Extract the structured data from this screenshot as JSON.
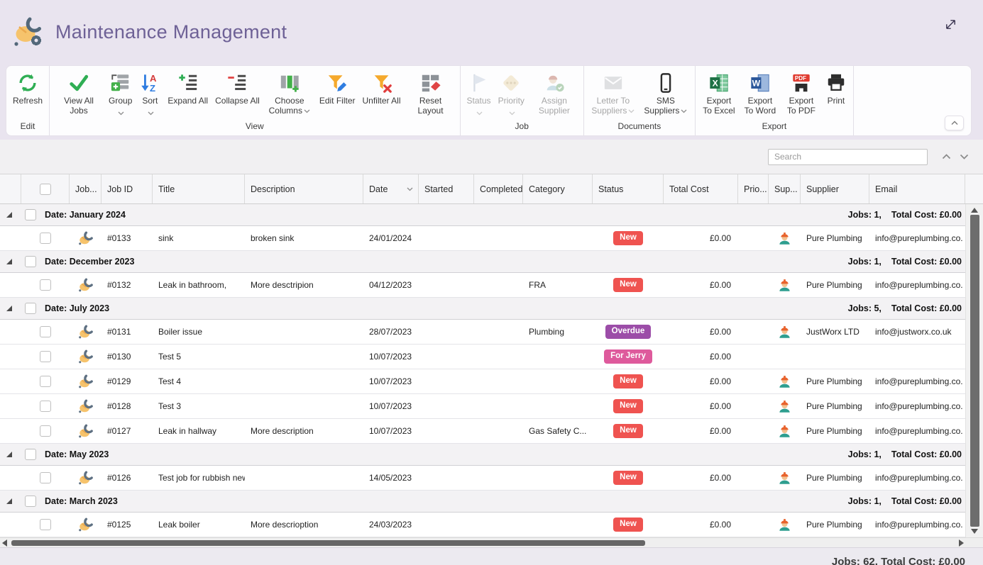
{
  "header": {
    "title": "Maintenance Management"
  },
  "ribbon": {
    "groups": [
      {
        "label": "Edit",
        "buttons": [
          {
            "label": "Refresh",
            "icon": "refresh-icon",
            "enabled": true,
            "dropdown": "none"
          }
        ]
      },
      {
        "label": "View",
        "buttons": [
          {
            "label": "View All Jobs",
            "icon": "check-icon",
            "enabled": true,
            "dropdown": "none"
          },
          {
            "label": "Group",
            "icon": "group-icon",
            "enabled": true,
            "dropdown": "below"
          },
          {
            "label": "Sort",
            "icon": "sort-az-icon",
            "enabled": true,
            "dropdown": "below"
          },
          {
            "label": "Expand All",
            "icon": "expand-all-icon",
            "enabled": true,
            "dropdown": "none"
          },
          {
            "label": "Collapse All",
            "icon": "collapse-all-icon",
            "enabled": true,
            "dropdown": "none"
          },
          {
            "label": "Choose Columns",
            "icon": "choose-columns-icon",
            "enabled": true,
            "dropdown": "inline"
          },
          {
            "label": "Edit Filter",
            "icon": "edit-filter-icon",
            "enabled": true,
            "dropdown": "none"
          },
          {
            "label": "Unfilter All",
            "icon": "unfilter-icon",
            "enabled": true,
            "dropdown": "none"
          },
          {
            "label": "Reset Layout",
            "icon": "reset-layout-icon",
            "enabled": true,
            "dropdown": "none"
          }
        ]
      },
      {
        "label": "Job",
        "buttons": [
          {
            "label": "Status",
            "icon": "status-flag-icon",
            "enabled": false,
            "dropdown": "below"
          },
          {
            "label": "Priority",
            "icon": "priority-icon",
            "enabled": false,
            "dropdown": "below"
          },
          {
            "label": "Assign Supplier",
            "icon": "assign-supplier-icon",
            "enabled": false,
            "dropdown": "none"
          }
        ]
      },
      {
        "label": "Documents",
        "buttons": [
          {
            "label": "Letter To Suppliers",
            "icon": "letter-icon",
            "enabled": false,
            "dropdown": "inline"
          },
          {
            "label": "SMS Suppliers",
            "icon": "sms-icon",
            "enabled": true,
            "dropdown": "inline"
          }
        ]
      },
      {
        "label": "Export",
        "buttons": [
          {
            "label": "Export To Excel",
            "icon": "excel-icon",
            "enabled": true,
            "dropdown": "none"
          },
          {
            "label": "Export To Word",
            "icon": "word-icon",
            "enabled": true,
            "dropdown": "none"
          },
          {
            "label": "Export To PDF",
            "icon": "pdf-icon",
            "enabled": true,
            "dropdown": "none"
          },
          {
            "label": "Print",
            "icon": "print-icon",
            "enabled": true,
            "dropdown": "none"
          }
        ]
      }
    ]
  },
  "search": {
    "placeholder": "Search"
  },
  "colors": {
    "accent_purple": "#6e6196",
    "status_colors": {
      "New": "#ef5350",
      "Overdue": "#9c4da8",
      "For Jerry": "#de5a9c"
    }
  },
  "grid": {
    "columns": [
      "",
      "",
      "Job...",
      "Job ID",
      "Title",
      "Description",
      "Date",
      "Started",
      "Completed",
      "Category",
      "Status",
      "Total Cost",
      "Prio...",
      "Sup...",
      "Supplier",
      "Email"
    ],
    "groups": [
      {
        "label": "Date: January 2024",
        "jobs": "Jobs: 1,",
        "total_cost": "Total Cost: £0.00",
        "rows": [
          {
            "job_id": "#0133",
            "title": "sink",
            "description": "broken sink",
            "date": "24/01/2024",
            "started": "",
            "completed": "",
            "category": "",
            "status": "New",
            "total_cost": "£0.00",
            "supplier": "Pure Plumbing",
            "email": "info@pureplumbing.co."
          }
        ]
      },
      {
        "label": "Date: December 2023",
        "jobs": "Jobs: 1,",
        "total_cost": "Total Cost: £0.00",
        "rows": [
          {
            "job_id": "#0132",
            "title": "Leak in bathroom,",
            "description": "More desctripion",
            "date": "04/12/2023",
            "started": "",
            "completed": "",
            "category": "FRA",
            "status": "New",
            "total_cost": "£0.00",
            "supplier": "Pure Plumbing",
            "email": "info@pureplumbing.co."
          }
        ]
      },
      {
        "label": "Date: July 2023",
        "jobs": "Jobs: 5,",
        "total_cost": "Total Cost: £0.00",
        "rows": [
          {
            "job_id": "#0131",
            "title": "Boiler issue",
            "description": "",
            "date": "28/07/2023",
            "started": "",
            "completed": "",
            "category": "Plumbing",
            "status": "Overdue",
            "total_cost": "£0.00",
            "supplier": "JustWorx LTD",
            "email": "info@justworx.co.uk"
          },
          {
            "job_id": "#0130",
            "title": "Test 5",
            "description": "",
            "date": "10/07/2023",
            "started": "",
            "completed": "",
            "category": "",
            "status": "For Jerry",
            "total_cost": "£0.00",
            "supplier": "",
            "email": ""
          },
          {
            "job_id": "#0129",
            "title": "Test 4",
            "description": "",
            "date": "10/07/2023",
            "started": "",
            "completed": "",
            "category": "",
            "status": "New",
            "total_cost": "£0.00",
            "supplier": "Pure Plumbing",
            "email": "info@pureplumbing.co."
          },
          {
            "job_id": "#0128",
            "title": "Test 3",
            "description": "",
            "date": "10/07/2023",
            "started": "",
            "completed": "",
            "category": "",
            "status": "New",
            "total_cost": "£0.00",
            "supplier": "Pure Plumbing",
            "email": "info@pureplumbing.co."
          },
          {
            "job_id": "#0127",
            "title": "Leak in hallway",
            "description": "More description",
            "date": "10/07/2023",
            "started": "",
            "completed": "",
            "category": "Gas Safety C...",
            "status": "New",
            "total_cost": "£0.00",
            "supplier": "Pure Plumbing",
            "email": "info@pureplumbing.co."
          }
        ]
      },
      {
        "label": "Date: May 2023",
        "jobs": "Jobs: 1,",
        "total_cost": "Total Cost: £0.00",
        "rows": [
          {
            "job_id": "#0126",
            "title": "Test job for rubbish new",
            "description": "",
            "date": "14/05/2023",
            "started": "",
            "completed": "",
            "category": "",
            "status": "New",
            "total_cost": "£0.00",
            "supplier": "Pure Plumbing",
            "email": "info@pureplumbing.co."
          }
        ]
      },
      {
        "label": "Date: March 2023",
        "jobs": "Jobs: 1,",
        "total_cost": "Total Cost: £0.00",
        "rows": [
          {
            "job_id": "#0125",
            "title": "Leak boiler",
            "description": "More descrioption",
            "date": "24/03/2023",
            "started": "",
            "completed": "",
            "category": "",
            "status": "New",
            "total_cost": "£0.00",
            "supplier": "Pure Plumbing",
            "email": "info@pureplumbing.co."
          }
        ]
      }
    ]
  },
  "statusbar": {
    "text": "Jobs: 62, Total Cost: £0.00"
  }
}
